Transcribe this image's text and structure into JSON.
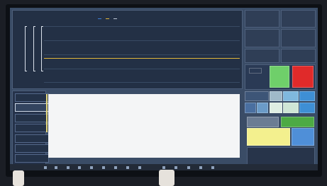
{
  "chart": {
    "title": "",
    "legend": [
      {
        "label": "",
        "color": "#3f7fd6"
      },
      {
        "label": "",
        "color": "#e0b63a"
      },
      {
        "label": "",
        "color": "#bfc9d6"
      }
    ]
  },
  "metrics": {
    "tile_1": {
      "label": "",
      "value": ""
    },
    "tile_2": {
      "label": "",
      "value": ""
    },
    "tile_3": {
      "label": "",
      "value": ""
    },
    "tile_4": {
      "label": "",
      "value": ""
    },
    "tile_5": {
      "label": "",
      "value": ""
    },
    "tile_6": {
      "label": "",
      "value": ""
    }
  },
  "buttons": {
    "red_small": "",
    "green_big": "",
    "stop": "",
    "green_wide": "",
    "grey_wide": "",
    "blue_wide": "",
    "yellow_big": ""
  },
  "left_panel": [
    {
      "label": "",
      "value": ""
    },
    {
      "label": "",
      "value": ""
    },
    {
      "label": "",
      "value": ""
    },
    {
      "label": "",
      "value": ""
    },
    {
      "label": "",
      "value": ""
    },
    {
      "label": "",
      "value": ""
    },
    {
      "label": "",
      "value": ""
    }
  ],
  "project_info": {
    "title": "",
    "rows": [
      "",
      "",
      "",
      ""
    ]
  },
  "colors": {
    "screen_bg": "#3a4c66",
    "chart_line": "#e0b63a",
    "stop_red": "#e02a2a",
    "green": "#5bb04a",
    "yellow": "#f3f08e",
    "blue": "#4f8fd8"
  }
}
